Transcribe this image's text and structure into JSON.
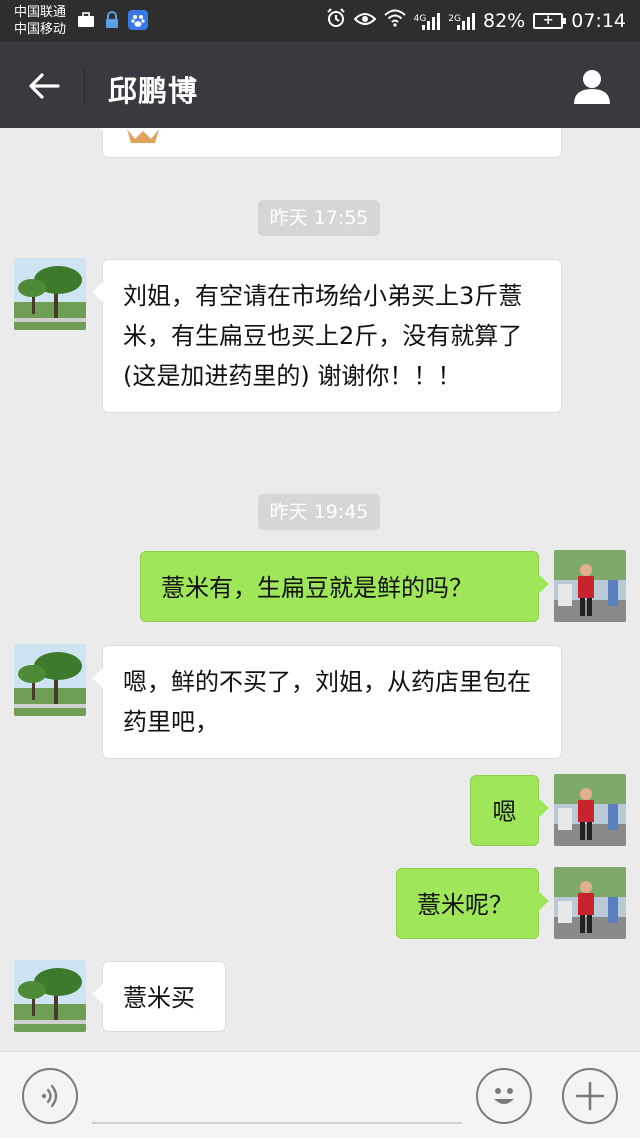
{
  "status_bar": {
    "carrier_1": "中国联通",
    "carrier_2": "中国移动",
    "net_1": "4G",
    "net_2": "2G",
    "battery_percent": "82%",
    "time": "07:14"
  },
  "header": {
    "title": "邱鹏博"
  },
  "messages": [
    {
      "type": "time",
      "text": "昨天 17:55"
    },
    {
      "type": "received",
      "text": "刘姐，有空请在市场给小弟买上3斤薏米，有生扁豆也买上2斤，没有就算了(这是加进药里的) 谢谢你！！！"
    },
    {
      "type": "time",
      "text": "昨天 19:45"
    },
    {
      "type": "sent",
      "text": "薏米有，生扁豆就是鲜的吗？"
    },
    {
      "type": "received",
      "text": "嗯，鲜的不买了，刘姐，从药店里包在药里吧，"
    },
    {
      "type": "sent",
      "text": "嗯"
    },
    {
      "type": "sent",
      "text": "薏米呢？"
    },
    {
      "type": "received",
      "text": "薏米买"
    }
  ],
  "colors": {
    "status_bar_bg": "#2e2e2e",
    "title_bar_bg": "#393a3f",
    "chat_bg": "#ebebeb",
    "sent_bubble": "#9fe658",
    "received_bubble": "#ffffff"
  }
}
